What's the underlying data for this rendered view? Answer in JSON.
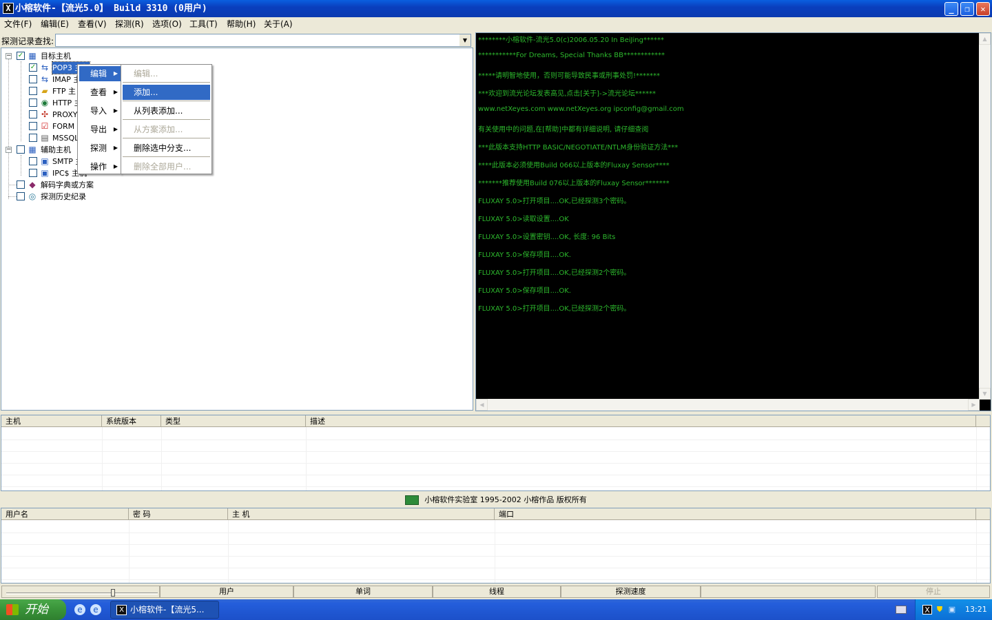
{
  "window": {
    "title": "小榕软件-【流光5.0】 Build 3310 (0用户)",
    "app_icon": "X",
    "minimize_symbol": "_",
    "maximize_symbol": "❐",
    "close_symbol": "✕"
  },
  "menubar": [
    "文件(F)",
    "编辑(E)",
    "查看(V)",
    "探测(R)",
    "选项(O)",
    "工具(T)",
    "帮助(H)",
    "关于(A)"
  ],
  "search": {
    "label": "探测记录查找:",
    "value": "",
    "arrow": "▼"
  },
  "tree": {
    "target_hosts": "目标主机",
    "pop3": "POP3 主机",
    "imap": "IMAP 主",
    "ftp": "FTP 主",
    "http": "HTTP 主",
    "proxy": "PROXY",
    "form": "FORM",
    "mssql": "MSSQL",
    "aux_hosts": "辅助主机",
    "smtp": "SMTP 主",
    "ipc": "IPC$ 主机",
    "dict": "解码字典或方案",
    "history": "探测历史纪录",
    "collapse_symbol": "−",
    "check_symbol": "✓"
  },
  "context_menu": {
    "items": [
      {
        "label": "编辑",
        "arrow": "▶",
        "highlighted": true
      },
      {
        "label": "查看",
        "arrow": "▶"
      },
      {
        "label": "导入",
        "arrow": "▶"
      },
      {
        "label": "导出",
        "arrow": "▶"
      },
      {
        "label": "探测",
        "arrow": "▶"
      },
      {
        "label": "操作",
        "arrow": "▶"
      }
    ]
  },
  "submenu": {
    "items": [
      {
        "label": "编辑...",
        "disabled": true
      },
      {
        "label": "添加...",
        "highlighted": true
      },
      {
        "label": "从列表添加..."
      },
      {
        "label": "从方案添加...",
        "disabled": true
      },
      {
        "label": "删除选中分支..."
      },
      {
        "label": "删除全部用户...",
        "disabled": true
      }
    ]
  },
  "console": {
    "lines": [
      "********小榕软件-流光5.0(c)2006.05.20 In BeiJing******",
      "***********For Dreams, Special Thanks BB************",
      "*****请明智地使用，否则可能导致民事或刑事处罚!*******",
      "***欢迎到流光论坛发表高见,点击[关于]->流光论坛******",
      "www.netXeyes.com www.netXeyes.org ipconfig@gmail.com",
      "有关使用中的问题,在[帮助]中都有详细说明, 请仔细查阅",
      "***此版本支持HTTP BASIC/NEGOTIATE/NTLM身份验证方法***",
      "****此版本必须使用Build 066以上版本的Fluxay Sensor****",
      "*******推荐使用Build 076以上版本的Fluxay Sensor*******",
      "FLUXAY 5.0>打开项目....OK,已经探测3个密码。",
      "FLUXAY 5.0>读取设置....OK",
      "FLUXAY 5.0>设置密钥....OK, 长度: 96 Bits",
      "FLUXAY 5.0>保存项目....OK.",
      "FLUXAY 5.0>打开项目....OK,已经探测2个密码。",
      "FLUXAY 5.0>保存项目....OK.",
      "FLUXAY 5.0>打开项目....OK,已经探测2个密码。"
    ],
    "text_color": "#2db82d",
    "scroll_up": "▲",
    "scroll_down": "▼",
    "scroll_left": "◀",
    "scroll_right": "▶"
  },
  "hosts_table": {
    "headers": [
      "主机",
      "系统版本",
      "类型",
      "描述"
    ]
  },
  "banner": {
    "text": "小榕软件实验室 1995-2002 小榕作品 版权所有"
  },
  "users_table": {
    "headers": [
      "用户名",
      "密 码",
      "主 机",
      "端口"
    ]
  },
  "statusbar": {
    "users": "用户",
    "words": "单词",
    "threads": "线程",
    "speed": "探测速度",
    "stop": "停止"
  },
  "taskbar": {
    "start": "开始",
    "task_title": "小榕软件-【流光5...",
    "task_icon": "X",
    "ie_icon": "e",
    "time": "13:21"
  }
}
